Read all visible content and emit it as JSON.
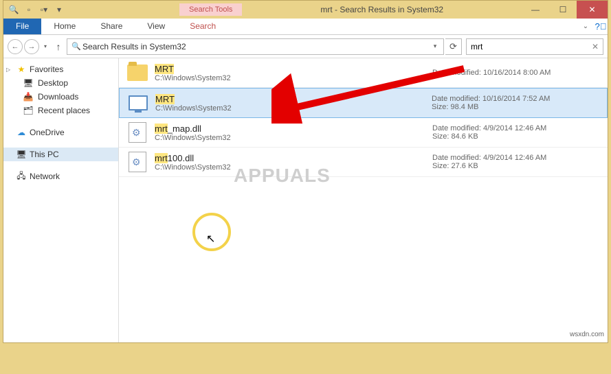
{
  "titlebar": {
    "contextual_tab": "Search Tools",
    "title": "mrt - Search Results in System32"
  },
  "ribbon": {
    "file": "File",
    "tabs": [
      "Home",
      "Share",
      "View"
    ],
    "search_tab": "Search"
  },
  "address_bar": {
    "path": "Search Results in System32"
  },
  "search": {
    "value": "mrt"
  },
  "sidebar": {
    "favorites": {
      "label": "Favorites",
      "items": [
        "Desktop",
        "Downloads",
        "Recent places"
      ]
    },
    "onedrive": "OneDrive",
    "thispc": "This PC",
    "network": "Network"
  },
  "results": [
    {
      "name_plain": "MRT",
      "name_hl": "MRT",
      "name_rest": "",
      "path": "C:\\Windows\\System32",
      "date_label": "Date modified:",
      "date": "10/16/2014 8:00 AM",
      "size_label": "",
      "size": "",
      "icon": "folder",
      "selected": false
    },
    {
      "name_plain": "MRT",
      "name_hl": "MRT",
      "name_rest": "",
      "path": "C:\\Windows\\System32",
      "date_label": "Date modified:",
      "date": "10/16/2014 7:52 AM",
      "size_label": "Size:",
      "size": "98.4 MB",
      "icon": "app",
      "selected": true
    },
    {
      "name_plain": "mrt_map.dll",
      "name_hl": "mrt",
      "name_rest": "_map.dll",
      "path": "C:\\Windows\\System32",
      "date_label": "Date modified:",
      "date": "4/9/2014 12:46 AM",
      "size_label": "Size:",
      "size": "84.6 KB",
      "icon": "dll",
      "selected": false
    },
    {
      "name_plain": "mrt100.dll",
      "name_hl": "mrt",
      "name_rest": "100.dll",
      "path": "C:\\Windows\\System32",
      "date_label": "Date modified:",
      "date": "4/9/2014 12:46 AM",
      "size_label": "Size:",
      "size": "27.6 KB",
      "icon": "dll",
      "selected": false
    }
  ],
  "watermark": "APPUALS",
  "attribution": "wsxdn.com"
}
